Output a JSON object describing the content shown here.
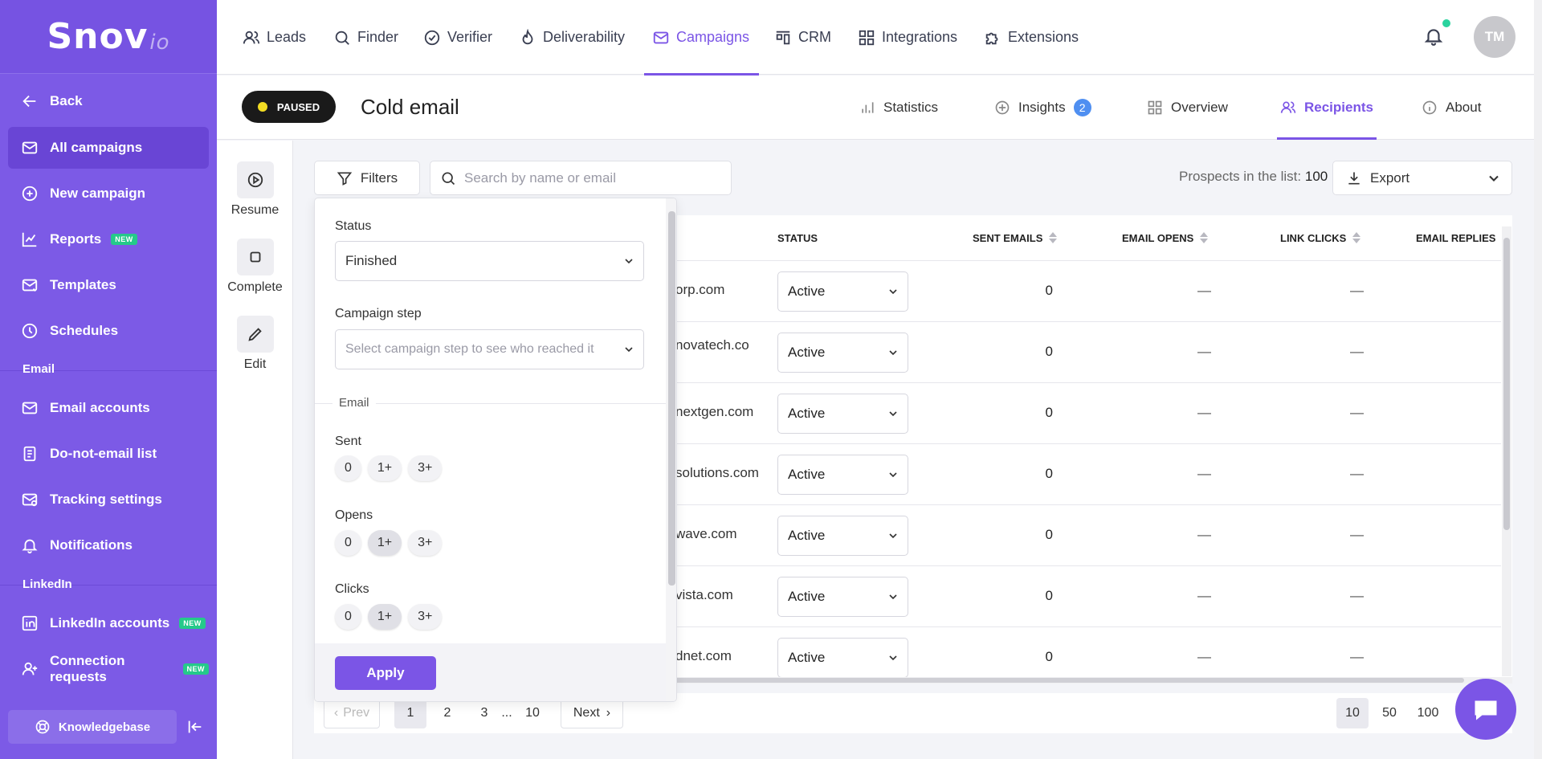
{
  "brand": {
    "name": "Snov",
    "suffix": "io"
  },
  "sidebar": {
    "back": "Back",
    "items": [
      {
        "label": "All campaigns",
        "icon": "envelope-icon",
        "active": true
      },
      {
        "label": "New campaign",
        "icon": "plus-circle-icon"
      },
      {
        "label": "Reports",
        "icon": "chart-icon",
        "badge": "NEW"
      },
      {
        "label": "Templates",
        "icon": "template-icon"
      },
      {
        "label": "Schedules",
        "icon": "clock-icon"
      }
    ],
    "section_email": "Email",
    "email_items": [
      {
        "label": "Email accounts",
        "icon": "envelope-icon"
      },
      {
        "label": "Do-not-email list",
        "icon": "document-icon"
      },
      {
        "label": "Tracking settings",
        "icon": "tracking-icon"
      },
      {
        "label": "Notifications",
        "icon": "bell-icon"
      }
    ],
    "section_linkedin": "LinkedIn",
    "linkedin_items": [
      {
        "label": "LinkedIn accounts",
        "icon": "linkedin-icon",
        "badge": "NEW"
      },
      {
        "label": "Connection requests",
        "icon": "user-plus-icon",
        "badge": "NEW"
      }
    ],
    "knowledgebase": "Knowledgebase"
  },
  "topnav": [
    {
      "label": "Leads"
    },
    {
      "label": "Finder"
    },
    {
      "label": "Verifier"
    },
    {
      "label": "Deliverability"
    },
    {
      "label": "Campaigns",
      "active": true
    },
    {
      "label": "CRM"
    },
    {
      "label": "Integrations"
    },
    {
      "label": "Extensions"
    }
  ],
  "user": {
    "initials": "TM"
  },
  "campaign": {
    "status": "PAUSED",
    "title": "Cold email",
    "tabs": [
      {
        "label": "Statistics"
      },
      {
        "label": "Insights",
        "badge": "2"
      },
      {
        "label": "Overview"
      },
      {
        "label": "Recipients",
        "active": true
      },
      {
        "label": "About"
      }
    ],
    "actions": [
      {
        "label": "Resume"
      },
      {
        "label": "Complete"
      },
      {
        "label": "Edit"
      }
    ]
  },
  "toolbar": {
    "filters": "Filters",
    "search_placeholder": "Search by name or email",
    "prospects_label": "Prospects in the list:",
    "prospects_count": "100",
    "export": "Export"
  },
  "table": {
    "headers": {
      "status": "STATUS",
      "sent": "SENT EMAILS",
      "opens": "EMAIL OPENS",
      "clicks": "LINK CLICKS",
      "replies": "EMAIL REPLIES"
    },
    "rows": [
      {
        "email": "orp.com",
        "status": "Active",
        "sent": "0",
        "opens": "—",
        "clicks": "—"
      },
      {
        "email": "novatech.co",
        "status": "Active",
        "sent": "0",
        "opens": "—",
        "clicks": "—"
      },
      {
        "email": "nextgen.com",
        "status": "Active",
        "sent": "0",
        "opens": "—",
        "clicks": "—"
      },
      {
        "email": "solutions.com",
        "status": "Active",
        "sent": "0",
        "opens": "—",
        "clicks": "—"
      },
      {
        "email": "wave.com",
        "status": "Active",
        "sent": "0",
        "opens": "—",
        "clicks": "—"
      },
      {
        "email": "vista.com",
        "status": "Active",
        "sent": "0",
        "opens": "—",
        "clicks": "—"
      },
      {
        "email": "dnet.com",
        "status": "Active",
        "sent": "0",
        "opens": "—",
        "clicks": "—"
      }
    ]
  },
  "pagination": {
    "prev": "Prev",
    "next": "Next",
    "pages": [
      "1",
      "2",
      "3",
      "...",
      "10"
    ],
    "current": "1",
    "sizes": [
      "10",
      "50",
      "100"
    ],
    "current_size": "10"
  },
  "filter_panel": {
    "status_label": "Status",
    "status_value": "Finished",
    "step_label": "Campaign step",
    "step_placeholder": "Select campaign step to see who reached it",
    "email_section": "Email",
    "groups": [
      {
        "label": "Sent",
        "options": [
          "0",
          "1+",
          "3+"
        ],
        "selected": null
      },
      {
        "label": "Opens",
        "options": [
          "0",
          "1+",
          "3+"
        ],
        "selected": "1+"
      },
      {
        "label": "Clicks",
        "options": [
          "0",
          "1+",
          "3+"
        ],
        "selected": "1+"
      }
    ],
    "apply": "Apply"
  }
}
